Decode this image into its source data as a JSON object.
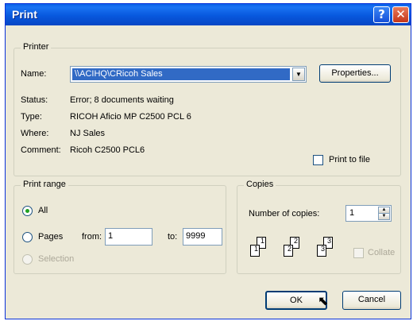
{
  "window": {
    "title": "Print"
  },
  "printer": {
    "legend": "Printer",
    "name_label": "Name:",
    "name_value": "\\\\ACIHQ\\CRicoh Sales",
    "properties_label": "Properties...",
    "status_label": "Status:",
    "status_value": "Error; 8 documents waiting",
    "type_label": "Type:",
    "type_value": "RICOH Aficio MP C2500 PCL 6",
    "where_label": "Where:",
    "where_value": "NJ Sales",
    "comment_label": "Comment:",
    "comment_value": "Ricoh C2500 PCL6",
    "print_to_file_label": "Print to file"
  },
  "print_range": {
    "legend": "Print range",
    "all_label": "All",
    "pages_label": "Pages",
    "from_label": "from:",
    "from_value": "1",
    "to_label": "to:",
    "to_value": "9999",
    "selection_label": "Selection"
  },
  "copies": {
    "legend": "Copies",
    "number_label": "Number of copies:",
    "number_value": "1",
    "collate_label": "Collate",
    "pages": [
      "1",
      "1",
      "2",
      "2",
      "3",
      "3"
    ]
  },
  "buttons": {
    "ok_label": "OK",
    "cancel_label": "Cancel"
  },
  "colors": {
    "titlebar": "#0858de",
    "dialog_bg": "#ece9d8",
    "selection": "#316ac5"
  }
}
